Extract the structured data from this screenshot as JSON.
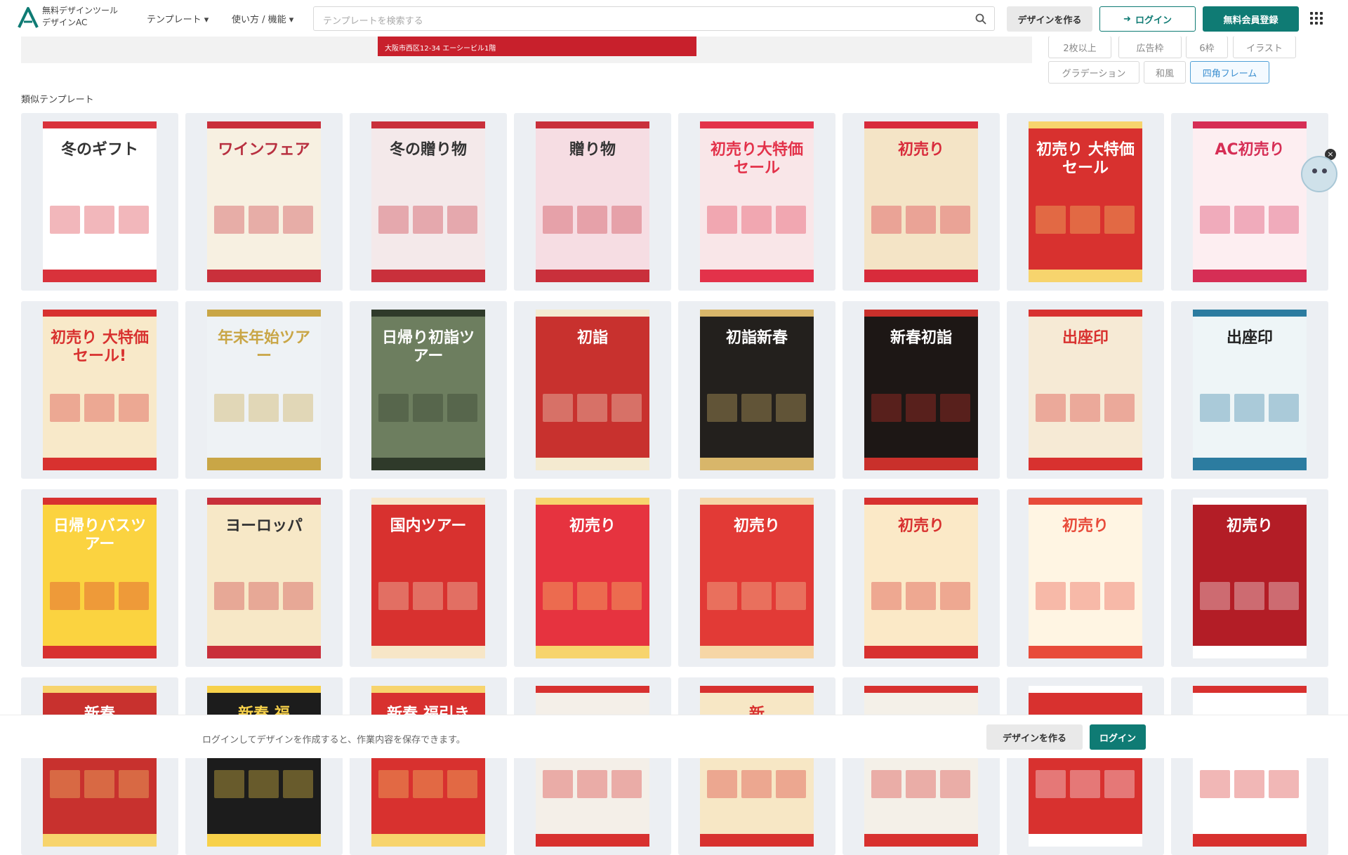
{
  "header": {
    "logo_line1": "無料デザインツール",
    "logo_line2": "デザインAC",
    "nav_templates": "テンプレート",
    "nav_usage": "使い方 / 機能",
    "search_placeholder": "テンプレートを検索する",
    "create_label": "デザインを作る",
    "login_label": "ログイン",
    "register_label": "無料会員登録",
    "accent_color": "#0f7b74"
  },
  "preview": {
    "banner_text": "大阪市西区12-34 エーシービル1階"
  },
  "tags": [
    "2枚以上",
    "広告枠",
    "6枠",
    "イラスト",
    "グラデーション",
    "和風",
    "四角フレーム"
  ],
  "active_tag": "四角フレーム",
  "section_title": "類似テンプレート",
  "templates": [
    {
      "title": "冬のギフト",
      "bg": "#ffffff",
      "accent": "#d9323b",
      "text": "#333333"
    },
    {
      "title": "ワインフェア",
      "bg": "#f7f0e1",
      "accent": "#c9303b",
      "text": "#b83040"
    },
    {
      "title": "冬の贈り物",
      "bg": "#f4e9ea",
      "accent": "#c9303b",
      "text": "#333333"
    },
    {
      "title": "贈り物",
      "bg": "#f6dde3",
      "accent": "#c9303b",
      "text": "#333333"
    },
    {
      "title": "初売り大特価セール",
      "bg": "#f9e6e8",
      "accent": "#e3324a",
      "text": "#e3324a"
    },
    {
      "title": "初売り",
      "bg": "#f4e4c6",
      "accent": "#d82b3b",
      "text": "#d82b3b"
    },
    {
      "title": "初売り 大特価セール",
      "bg": "#d8312f",
      "accent": "#f7d46d",
      "text": "#ffffff"
    },
    {
      "title": "AC初売り",
      "bg": "#fdeef1",
      "accent": "#d62e55",
      "text": "#d62e55"
    },
    {
      "title": "初売り 大特価セール!",
      "bg": "#f8e9c9",
      "accent": "#d8312f",
      "text": "#d8312f"
    },
    {
      "title": "年末年始ツアー",
      "bg": "#eef2f5",
      "accent": "#c9a646",
      "text": "#c9a646"
    },
    {
      "title": "日帰り初詣ツアー",
      "bg": "#6d7e5f",
      "accent": "#2f3a2a",
      "text": "#ffffff"
    },
    {
      "title": "初詣",
      "bg": "#c8312e",
      "accent": "#f4ead0",
      "text": "#ffffff"
    },
    {
      "title": "初詣新春",
      "bg": "#23201d",
      "accent": "#d8b66a",
      "text": "#ffffff"
    },
    {
      "title": "新春初詣",
      "bg": "#1d1715",
      "accent": "#c9302b",
      "text": "#ffffff"
    },
    {
      "title": "出座印",
      "bg": "#f6ead5",
      "accent": "#d8312f",
      "text": "#d8312f"
    },
    {
      "title": "出座印",
      "bg": "#eef5f7",
      "accent": "#2c7ca0",
      "text": "#222222"
    },
    {
      "title": "日帰りバスツアー",
      "bg": "#fbd340",
      "accent": "#d8312f",
      "text": "#ffffff"
    },
    {
      "title": "ヨーロッパ",
      "bg": "#f7e8c7",
      "accent": "#c9303b",
      "text": "#333333"
    },
    {
      "title": "国内ツアー",
      "bg": "#d8312f",
      "accent": "#f7e6c7",
      "text": "#ffffff"
    },
    {
      "title": "初売り",
      "bg": "#e6333f",
      "accent": "#f7d46d",
      "text": "#ffffff"
    },
    {
      "title": "初売り",
      "bg": "#e23a36",
      "accent": "#f6d6a6",
      "text": "#ffffff"
    },
    {
      "title": "初売り",
      "bg": "#fbe9c7",
      "accent": "#d8312f",
      "text": "#d8312f"
    },
    {
      "title": "初売り",
      "bg": "#fff5e3",
      "accent": "#e84b3a",
      "text": "#e84b3a"
    },
    {
      "title": "初売り",
      "bg": "#b31d26",
      "accent": "#ffffff",
      "text": "#ffffff"
    },
    {
      "title": "新春",
      "bg": "#c8312e",
      "accent": "#f7d46d",
      "text": "#ffffff"
    },
    {
      "title": "新春 福",
      "bg": "#1c1c1c",
      "accent": "#f7d14a",
      "text": "#f7d14a"
    },
    {
      "title": "新春 福引き",
      "bg": "#d8312f",
      "accent": "#f7d46d",
      "text": "#ffffff"
    },
    {
      "title": "",
      "bg": "#f4efe8",
      "accent": "#d8312f",
      "text": "#333333"
    },
    {
      "title": "新",
      "bg": "#f7e7c5",
      "accent": "#d8312f",
      "text": "#d8312f"
    },
    {
      "title": "",
      "bg": "#f4f0e8",
      "accent": "#d8312f",
      "text": "#333333"
    },
    {
      "title": "",
      "bg": "#d8312f",
      "accent": "#ffffff",
      "text": "#ffffff"
    },
    {
      "title": "",
      "bg": "#ffffff",
      "accent": "#d8312f",
      "text": "#d8312f"
    }
  ],
  "bottom": {
    "message": "ログインしてデザインを作成すると、作業内容を保存できます。",
    "create_label": "デザインを作る",
    "login_label": "ログイン"
  }
}
